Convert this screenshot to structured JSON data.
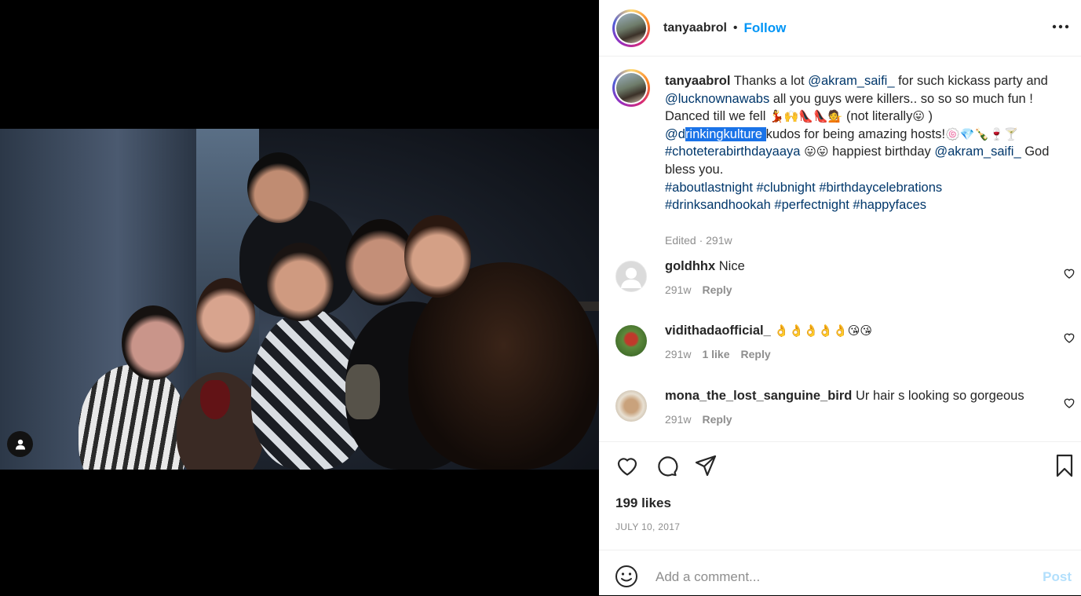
{
  "post": {
    "username": "tanyaabrol",
    "separator": "•",
    "follow_label": "Follow",
    "more_icon": "more-horizontal-icon"
  },
  "caption": {
    "username": "tanyaabrol",
    "part1": " Thanks a lot ",
    "mention1": "@akram_saifi_",
    "part2": " for such kickass party and ",
    "mention2": "@lucknownawabs",
    "part3": " all you guys were killers.. so so so much fun ! Danced till we fell ",
    "emojis1": "💃🙌👠👠💁",
    "part4": " (not literally",
    "emoji_tongue": "😛",
    "part5": " )",
    "mention3_prefix": "@d",
    "mention3_selected": "rinkingkulture ",
    "part6": "kudos for being amazing hosts!",
    "emojis2": "🍥💎🍾🍷🍸",
    "hashtag1": "#choteterabirthdayaaya",
    "emojis3": " 😛😛",
    "part7": " happiest birthday ",
    "mention4": "@akram_saifi_",
    "part8": " God bless you.",
    "hashtags_line1": "#aboutlastnight #clubnight #birthdaycelebrations",
    "hashtags_line2": "#drinksandhookah #perfectnight #happyfaces",
    "meta": "Edited · 291w"
  },
  "comments": [
    {
      "username": "goldhhx",
      "text": "Nice",
      "age": "291w",
      "likes": "",
      "reply": "Reply"
    },
    {
      "username": "vidithadaofficial_",
      "text": "👌👌👌👌👌😘😘",
      "age": "291w",
      "likes": "1 like",
      "reply": "Reply"
    },
    {
      "username": "mona_the_lost_sanguine_bird",
      "text": "Ur hair s looking so gorgeous",
      "age": "291w",
      "likes": "",
      "reply": "Reply"
    }
  ],
  "actions": {
    "like_icon": "heart-icon",
    "comment_icon": "comment-icon",
    "share_icon": "share-icon",
    "save_icon": "bookmark-icon"
  },
  "likes": "199 likes",
  "date": "JULY 10, 2017",
  "add_comment": {
    "placeholder": "Add a comment...",
    "post_label": "Post",
    "emoji_icon": "smiley-icon"
  },
  "colors": {
    "link": "#00376b",
    "follow": "#0095f6",
    "muted": "#8e8e8e",
    "post_disabled": "#b2dffc",
    "selection": "#1a73e8"
  }
}
